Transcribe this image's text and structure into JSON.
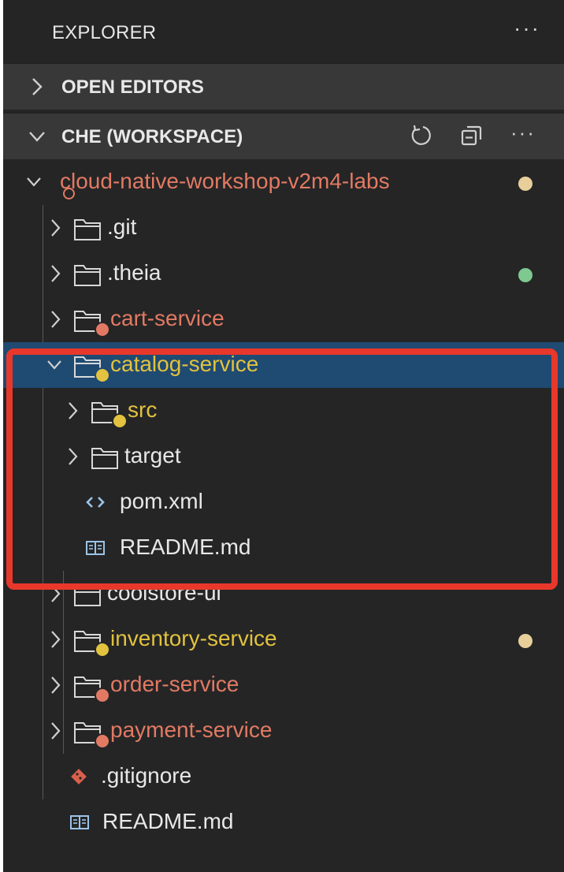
{
  "explorer": {
    "title": "EXPLORER",
    "more": "···"
  },
  "sections": {
    "open_editors": {
      "label": "OPEN EDITORS"
    },
    "workspace": {
      "label": "CHE (WORKSPACE)",
      "more": "···"
    }
  },
  "tree": {
    "root": {
      "label": "cloud-native-workshop-v2m4-labs"
    },
    "git": {
      "label": ".git"
    },
    "theia": {
      "label": ".theia"
    },
    "cart": {
      "label": "cart-service"
    },
    "catalog": {
      "label": "catalog-service"
    },
    "src": {
      "label": "src"
    },
    "target": {
      "label": "target"
    },
    "pom": {
      "label": "pom.xml"
    },
    "catalog_readme": {
      "label": "README.md"
    },
    "coolstore": {
      "label": "coolstore-ui"
    },
    "inventory": {
      "label": "inventory-service"
    },
    "order": {
      "label": "order-service"
    },
    "payment": {
      "label": "payment-service"
    },
    "gitignore": {
      "label": ".gitignore"
    },
    "readme": {
      "label": "README.md"
    }
  },
  "colors": {
    "panel_bg": "#252526",
    "section_bg": "#383838",
    "selected_bg": "#1f4a72",
    "modified_red": "#e27a63",
    "warning_yellow": "#e2c23e",
    "dot_modified": "#e8cf9a",
    "dot_untracked": "#7ec98f",
    "highlight_border": "#e8382b"
  }
}
